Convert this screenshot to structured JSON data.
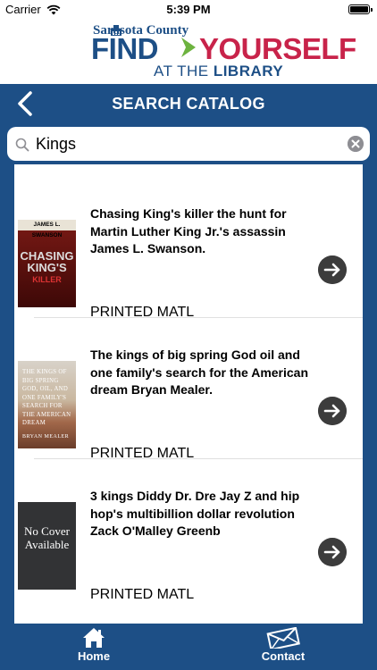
{
  "status_bar": {
    "carrier": "Carrier",
    "time": "5:39 PM"
  },
  "logo": {
    "county": "Sarasota County",
    "find": "FIND",
    "yourself": "YOURSELF",
    "at_the": "AT THE",
    "library": "LIBRARY",
    "colors": {
      "blue": "#1d4f86",
      "red": "#c8234a",
      "green": "#6db33f"
    }
  },
  "nav": {
    "title": "SEARCH CATALOG",
    "back_icon": "chevron-left-icon"
  },
  "search": {
    "value": "Kings",
    "placeholder": ""
  },
  "results": [
    {
      "title": "Chasing King's killer the hunt for Martin Luther King Jr.'s assassin James L. Swanson.",
      "format": "PRINTED MATL",
      "cover": {
        "top": "JAMES L. SWANSON",
        "title_line1": "CHASING",
        "title_line2": "KING'S",
        "subtitle": "KILLER"
      }
    },
    {
      "title": "The kings of big spring God oil and one family's search for the American dream Bryan Mealer.",
      "format": "PRINTED MATL",
      "cover": {
        "text": "THE KINGS OF BIG SPRING GOD, OIL, AND ONE FAMILY'S SEARCH FOR THE AMERICAN DREAM",
        "author": "BRYAN MEALER"
      }
    },
    {
      "title": "3 kings Diddy Dr. Dre Jay Z and hip hop's multibillion dollar revolution Zack O'Malley Greenb",
      "format": "PRINTED MATL",
      "cover": {
        "text": "No Cover Available"
      }
    }
  ],
  "tab_bar": {
    "home": "Home",
    "contact": "Contact"
  },
  "colors": {
    "brand_blue": "#1d4f86",
    "arrow_button": "#3c3c3c"
  }
}
